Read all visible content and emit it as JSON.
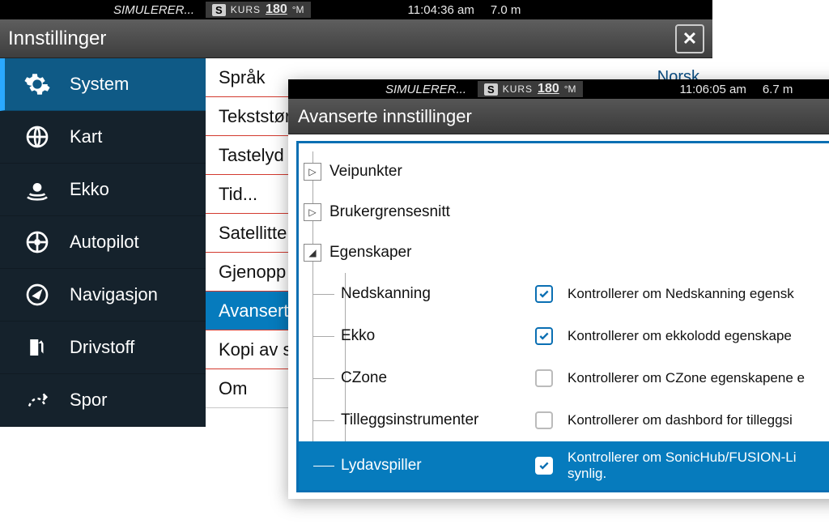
{
  "back": {
    "status": {
      "sim": "SIMULERER...",
      "s": "S",
      "hdg_label": "KURS",
      "hdg_value": "180",
      "hdg_unit": "°M",
      "time": "11:04:36 am",
      "depth": "7.0 m"
    },
    "title": "Innstillinger",
    "sidebar": [
      {
        "label": "System",
        "active": true
      },
      {
        "label": "Kart"
      },
      {
        "label": "Ekko"
      },
      {
        "label": "Autopilot"
      },
      {
        "label": "Navigasjon"
      },
      {
        "label": "Drivstoff"
      },
      {
        "label": "Spor"
      }
    ],
    "rows": [
      {
        "label": "Språk",
        "value": "Norsk"
      },
      {
        "label": "Tekststør"
      },
      {
        "label": "Tastelyd"
      },
      {
        "label": "Tid..."
      },
      {
        "label": "Satellitte"
      },
      {
        "label": "Gjenopp"
      },
      {
        "label": "Avansert",
        "selected": true
      },
      {
        "label": "Kopi av s"
      },
      {
        "label": "Om"
      }
    ]
  },
  "front": {
    "status": {
      "sim": "SIMULERER...",
      "s": "S",
      "hdg_label": "KURS",
      "hdg_value": "180",
      "hdg_unit": "°M",
      "time": "11:06:05 am",
      "depth": "6.7 m"
    },
    "title": "Avanserte innstillinger",
    "nodes": [
      {
        "label": "Veipunkter",
        "expanded": false
      },
      {
        "label": "Brukergrensesnitt",
        "expanded": false
      },
      {
        "label": "Egenskaper",
        "expanded": true
      }
    ],
    "features": [
      {
        "name": "Nedskanning",
        "checked": true,
        "desc": "Kontrollerer om Nedskanning egensk"
      },
      {
        "name": "Ekko",
        "checked": true,
        "desc": "Kontrollerer om ekkolodd egenskape"
      },
      {
        "name": "CZone",
        "checked": false,
        "desc": "Kontrollerer om CZone egenskapene e"
      },
      {
        "name": "Tilleggsinstrumenter",
        "checked": false,
        "desc": "Kontrollerer om dashbord for tilleggsi"
      },
      {
        "name": "Lydavspiller",
        "checked": true,
        "selected": true,
        "desc": "Kontrollerer om SonicHub/FUSION-Li",
        "desc2": "synlig."
      }
    ]
  }
}
